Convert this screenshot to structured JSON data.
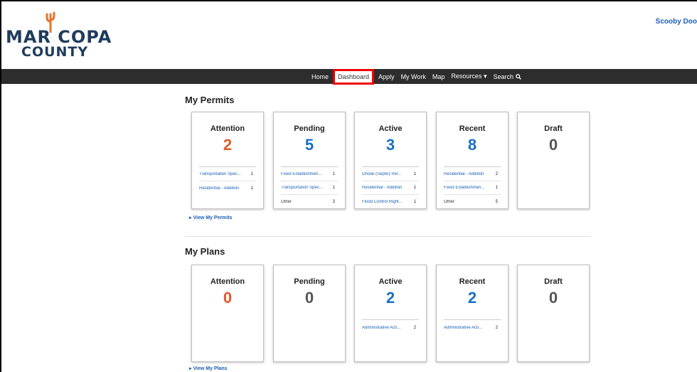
{
  "brand": {
    "line1": "MAR COPA",
    "line2": "COUNTY"
  },
  "header": {
    "user_link": "Scooby Doo"
  },
  "nav": {
    "home": "Home",
    "dashboard": "Dashboard",
    "apply": "Apply",
    "mywork": "My Work",
    "map": "Map",
    "resources": "Resources ▾",
    "search": "Search"
  },
  "permits": {
    "title": "My Permits",
    "view_link": "▸ View My Permits",
    "cards": [
      {
        "label": "Attention",
        "count": "2",
        "color": "#e05a2b",
        "rows": [
          {
            "label": "Transportation Spec...",
            "count": "1"
          },
          {
            "label": "Residential - Addition",
            "count": "1"
          }
        ]
      },
      {
        "label": "Pending",
        "count": "5",
        "color": "#1a6fc4",
        "rows": [
          {
            "label": "Fixed Establishmen...",
            "count": "1"
          },
          {
            "label": "Transportation Spec...",
            "count": "1"
          },
          {
            "label": "Other",
            "count": "3"
          }
        ]
      },
      {
        "label": "Active",
        "count": "3",
        "color": "#1a6fc4",
        "rows": [
          {
            "label": "Onsite (Septic) Per...",
            "count": "1"
          },
          {
            "label": "Residential - Addition",
            "count": "1"
          },
          {
            "label": "Flood Control Right...",
            "count": "1"
          }
        ]
      },
      {
        "label": "Recent",
        "count": "8",
        "color": "#1a6fc4",
        "rows": [
          {
            "label": "Residential - Addition",
            "count": "2"
          },
          {
            "label": "Fixed Establishmen...",
            "count": "1"
          },
          {
            "label": "Other",
            "count": "5"
          }
        ]
      },
      {
        "label": "Draft",
        "count": "0",
        "color": "#555555",
        "rows": []
      }
    ]
  },
  "plans": {
    "title": "My Plans",
    "view_link": "▸ View My Plans",
    "cards": [
      {
        "label": "Attention",
        "count": "0",
        "color": "#e05a2b",
        "rows": []
      },
      {
        "label": "Pending",
        "count": "0",
        "color": "#555555",
        "rows": []
      },
      {
        "label": "Active",
        "count": "2",
        "color": "#1a6fc4",
        "rows": [
          {
            "label": "Administrative Acti...",
            "count": "2"
          }
        ]
      },
      {
        "label": "Recent",
        "count": "2",
        "color": "#1a6fc4",
        "rows": [
          {
            "label": "Administrative Acti...",
            "count": "2"
          }
        ]
      },
      {
        "label": "Draft",
        "count": "0",
        "color": "#555555",
        "rows": []
      }
    ]
  }
}
